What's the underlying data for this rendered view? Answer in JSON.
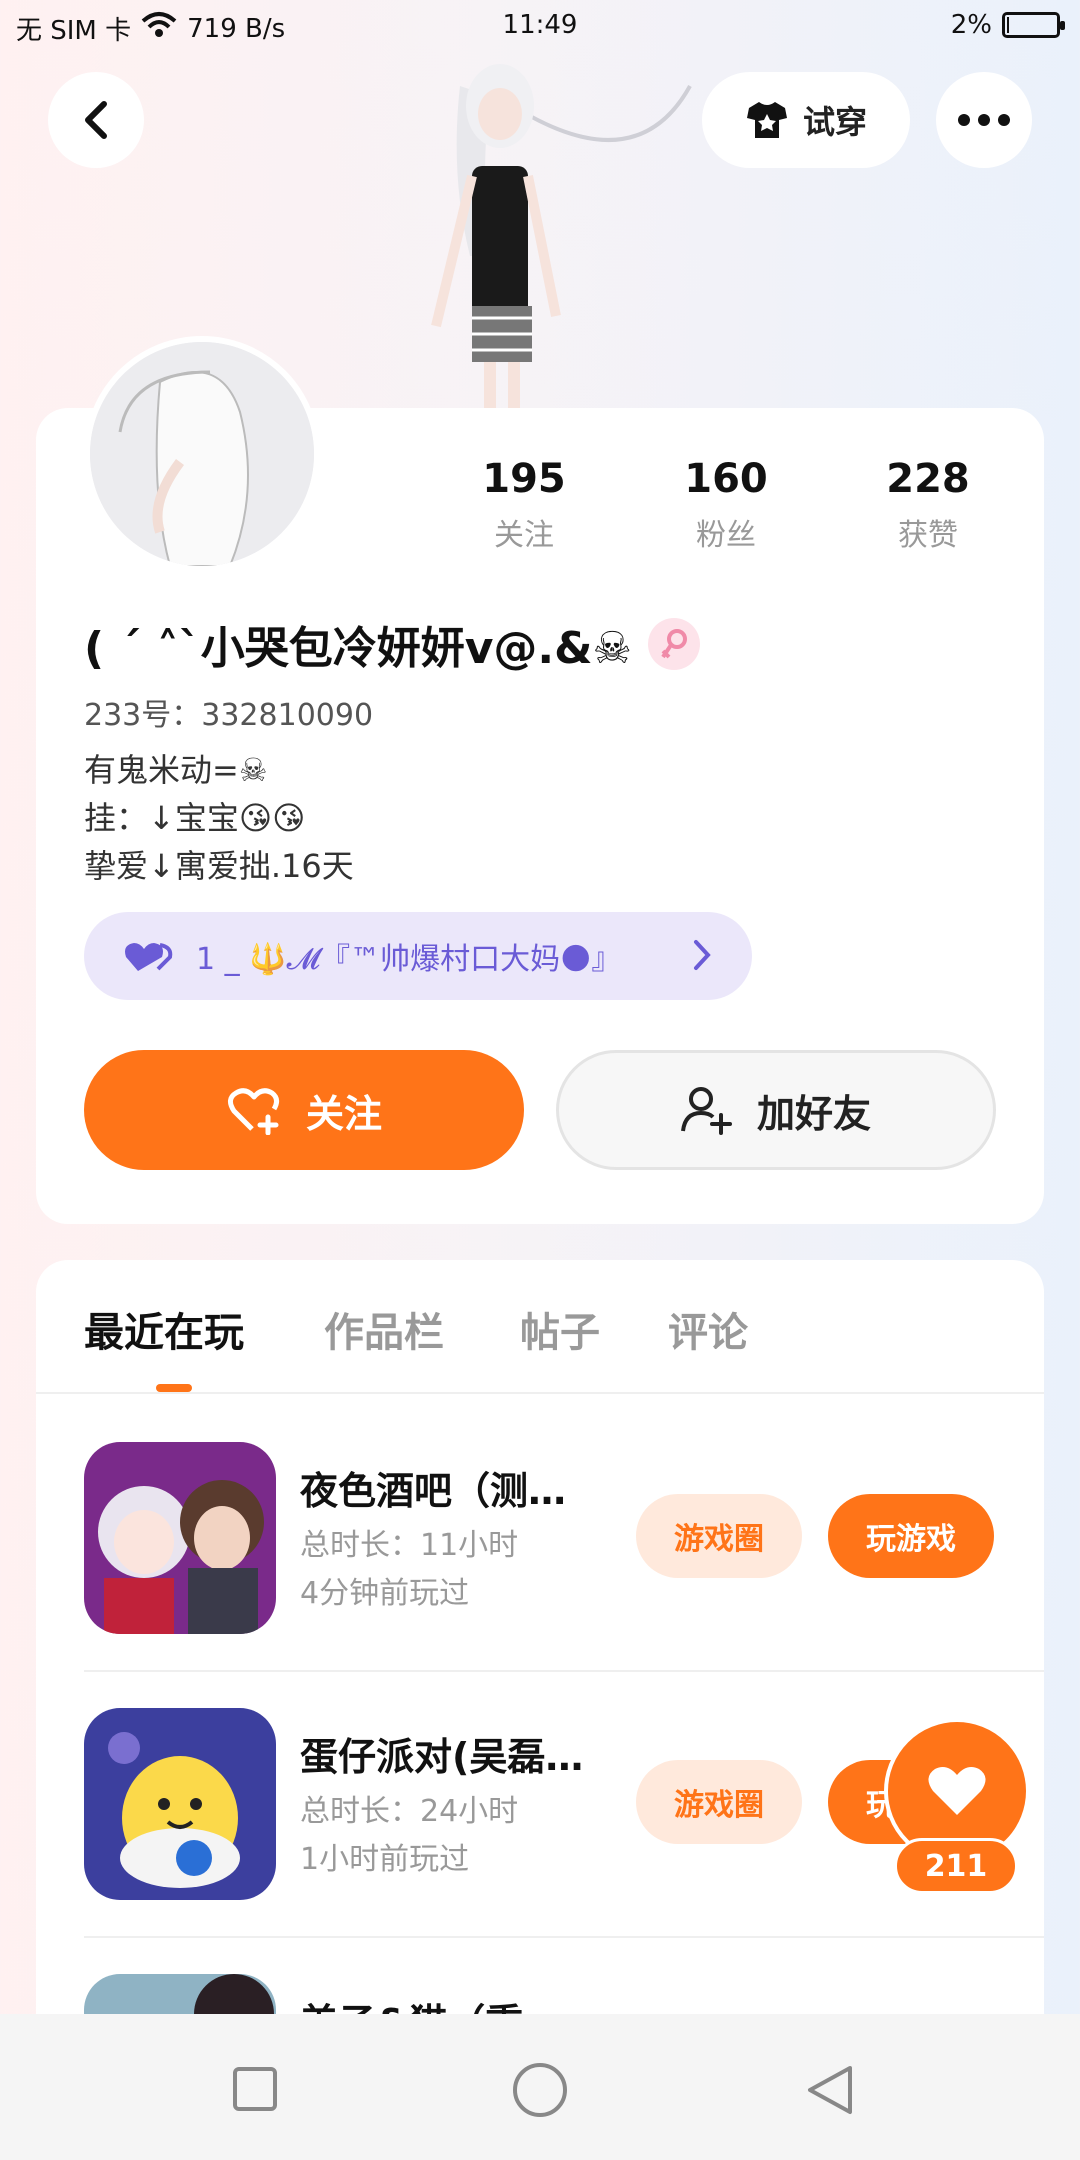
{
  "status_bar": {
    "carrier": "无 SIM 卡",
    "speed": "719 B/s",
    "time": "11:49",
    "battery": "2%",
    "battery_level": 0.02
  },
  "header": {
    "try_on_label": "试穿"
  },
  "profile": {
    "stats": [
      {
        "value": "195",
        "label": "关注"
      },
      {
        "value": "160",
        "label": "粉丝"
      },
      {
        "value": "228",
        "label": "获赞"
      }
    ],
    "nickname": "( ˊ ˄ˋ小哭包冷妍妍v@.&☠",
    "uid": "233号：332810090",
    "bio_lines": [
      "有鬼米动=☠",
      "挂：↓宝宝😘😘",
      "挚爱↓寓爱拙.16天"
    ],
    "bond_text": "1 _ 🔱𝓜『™帅爆村口大妈🌑』",
    "follow_label": "关注",
    "add_friend_label": "加好友"
  },
  "tabs": [
    "最近在玩",
    "作品栏",
    "帖子",
    "评论"
  ],
  "games": [
    {
      "title": "夜色酒吧（测试版）",
      "duration": "总时长：11小时",
      "last_played": "4分钟前玩过",
      "circle_label": "游戏圈",
      "play_label": "玩游戏"
    },
    {
      "title": "蛋仔派对(吴磊代言)",
      "duration": "总时长：24小时",
      "last_played": "1小时前玩过",
      "circle_label": "游戏圈",
      "play_label": "玩游戏"
    },
    {
      "title": "美子&猫（重",
      "duration": "",
      "last_played": "",
      "circle_label": "",
      "play_label": ""
    }
  ],
  "like_count": "211",
  "colors": {
    "accent": "#ff7418",
    "accent_soft": "#ffe9dc",
    "bond_bg": "#ebe7fa",
    "bond_text": "#6a5bd6"
  }
}
